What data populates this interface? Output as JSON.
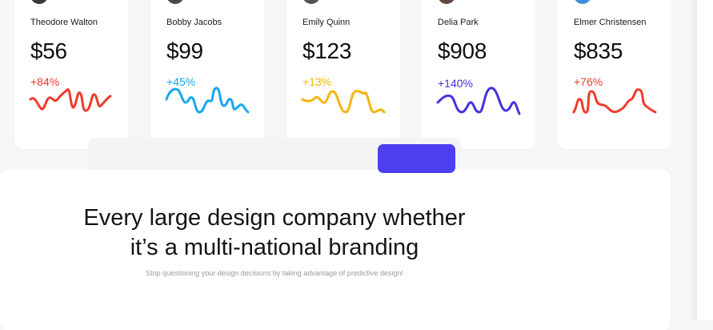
{
  "cards": [
    {
      "name": "Theodore Walton",
      "price": "$56",
      "change": "+84%",
      "color": "#ef3b2c",
      "avatar_color": "#3a3a3a"
    },
    {
      "name": "Bobby Jacobs",
      "price": "$99",
      "change": "+45%",
      "color": "#18a7f0",
      "avatar_color": "#4a4a4a"
    },
    {
      "name": "Emily Quinn",
      "price": "$123",
      "change": "+13%",
      "color": "#f5b40e",
      "avatar_color": "#555555"
    },
    {
      "name": "Delia Park",
      "price": "$908",
      "change": "+140%",
      "color": "#4433e0",
      "avatar_color": "#5a4a3f"
    },
    {
      "name": "Elmer Christensen",
      "price": "$835",
      "change": "+76%",
      "color": "#ef3b2c",
      "avatar_color": "#3b8fd9"
    }
  ],
  "promo": {
    "headline_line1": "Every large design company whether",
    "headline_line2": "it’s a multi-national branding",
    "subtext": "Stop questioning your design decisions by taking advantage of predictive design!"
  },
  "colors": {
    "accent": "#4b3ff0",
    "background": "#f6f6f6",
    "card": "#ffffff"
  }
}
